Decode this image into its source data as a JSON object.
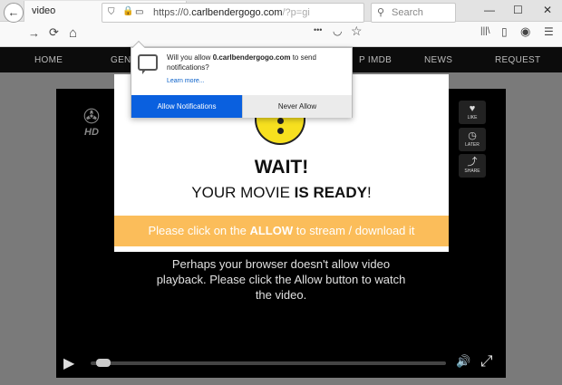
{
  "browser": {
    "tab_title": "video",
    "tab_close": "×",
    "new_tab": "+",
    "window_controls": [
      "—",
      "☐",
      "✕"
    ],
    "url_prefix": "https://0.",
    "url_host": "carlbendergogo.com",
    "url_suffix": "/?p=gi",
    "search_placeholder": "Search",
    "nav_glyphs": {
      "back": "←",
      "forward": "→",
      "reload": "⟳",
      "home": "⌂",
      "more": "•••",
      "menu": "☰",
      "library": "|||\\"
    }
  },
  "site_nav": {
    "items": [
      "HOME",
      "GENI",
      "P IMDB",
      "NEWS",
      "REQUEST"
    ]
  },
  "player": {
    "hd_label": "HD",
    "side_buttons": [
      {
        "label": "LIKE",
        "glyph": "♥"
      },
      {
        "label": "LATER",
        "glyph": "◷"
      },
      {
        "label": "SHARE",
        "glyph": "⤴"
      }
    ],
    "message_line1": "Perhaps your browser doesn't allow video",
    "message_line2": "playback. Please click the Allow button to watch",
    "message_line3": "the video.",
    "play_glyph": "▶",
    "volume_glyph": "🔊",
    "fullscreen_glyph": "⤢",
    "progress_fraction": 0.02
  },
  "modal": {
    "wait": "WAIT!",
    "ready_prefix": "YOUR MOVIE ",
    "ready_bold": "IS READY",
    "ready_suffix": "!",
    "banner_prefix": "Please click on the ",
    "banner_bold": "ALLOW",
    "banner_suffix": " to stream / download it"
  },
  "notification": {
    "question_prefix": "Will you allow ",
    "question_host": "0.carlbendergogo.com",
    "question_suffix": " to send notifications?",
    "learn_more": "Learn more...",
    "allow_label": "Allow Notifications",
    "never_label": "Never Allow"
  },
  "colors": {
    "accent_blue": "#0a60df",
    "banner_orange": "#fbbd5a",
    "face_yellow": "#f7e01f"
  }
}
